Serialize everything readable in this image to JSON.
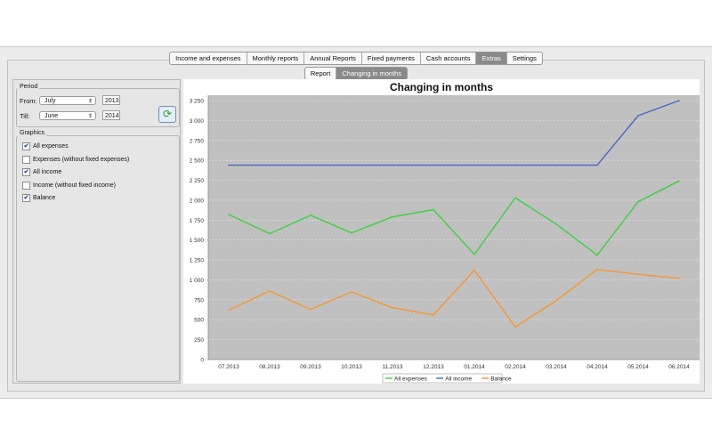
{
  "tabs": [
    "Income and expenses",
    "Monthly reports",
    "Annual Reports",
    "Fixed payments",
    "Cash accounts",
    "Extras",
    "Settings"
  ],
  "active_tab": 5,
  "subtabs": [
    "Report",
    "Changing in months"
  ],
  "active_subtab": 1,
  "period": {
    "title": "Period",
    "from_label": "From:",
    "from_month": "July",
    "from_year": "2013",
    "till_label": "Till:",
    "till_month": "June",
    "till_year": "2014"
  },
  "graphics": {
    "title": "Graphics",
    "options": [
      {
        "label": "All expenses",
        "checked": true
      },
      {
        "label": "Expenses (without fixed expenses)",
        "checked": false
      },
      {
        "label": "All income",
        "checked": true
      },
      {
        "label": "Income (without fixed income)",
        "checked": false
      },
      {
        "label": "Balance",
        "checked": true
      }
    ]
  },
  "icons": {
    "refresh": "refresh-icon"
  },
  "chart_data": {
    "type": "line",
    "title": "Changing in months",
    "categories": [
      "07.2013",
      "08.2013",
      "09.2013",
      "10.2013",
      "11.2013",
      "12.2013",
      "01.2014",
      "02.2014",
      "03.2014",
      "04.2014",
      "05.2014",
      "06.2014"
    ],
    "ylim": [
      0,
      3250
    ],
    "yticks": [
      "0",
      "250",
      "500",
      "750",
      "1 000",
      "1 250",
      "1 500",
      "1 750",
      "2 000",
      "2 250",
      "2 500",
      "2 750",
      "3 000",
      "3 250"
    ],
    "series": [
      {
        "name": "All expenses",
        "color": "#3fcf3f",
        "values": [
          1820,
          1580,
          1810,
          1590,
          1790,
          1880,
          1320,
          2030,
          1700,
          1310,
          1980,
          2240
        ]
      },
      {
        "name": "All income",
        "color": "#4a68c2",
        "values": [
          2440,
          2440,
          2440,
          2440,
          2440,
          2440,
          2440,
          2440,
          2440,
          2440,
          3060,
          3250
        ]
      },
      {
        "name": "Balance",
        "color": "#f59634",
        "values": [
          620,
          860,
          630,
          850,
          650,
          560,
          1120,
          410,
          740,
          1130,
          1070,
          1020
        ]
      }
    ]
  }
}
